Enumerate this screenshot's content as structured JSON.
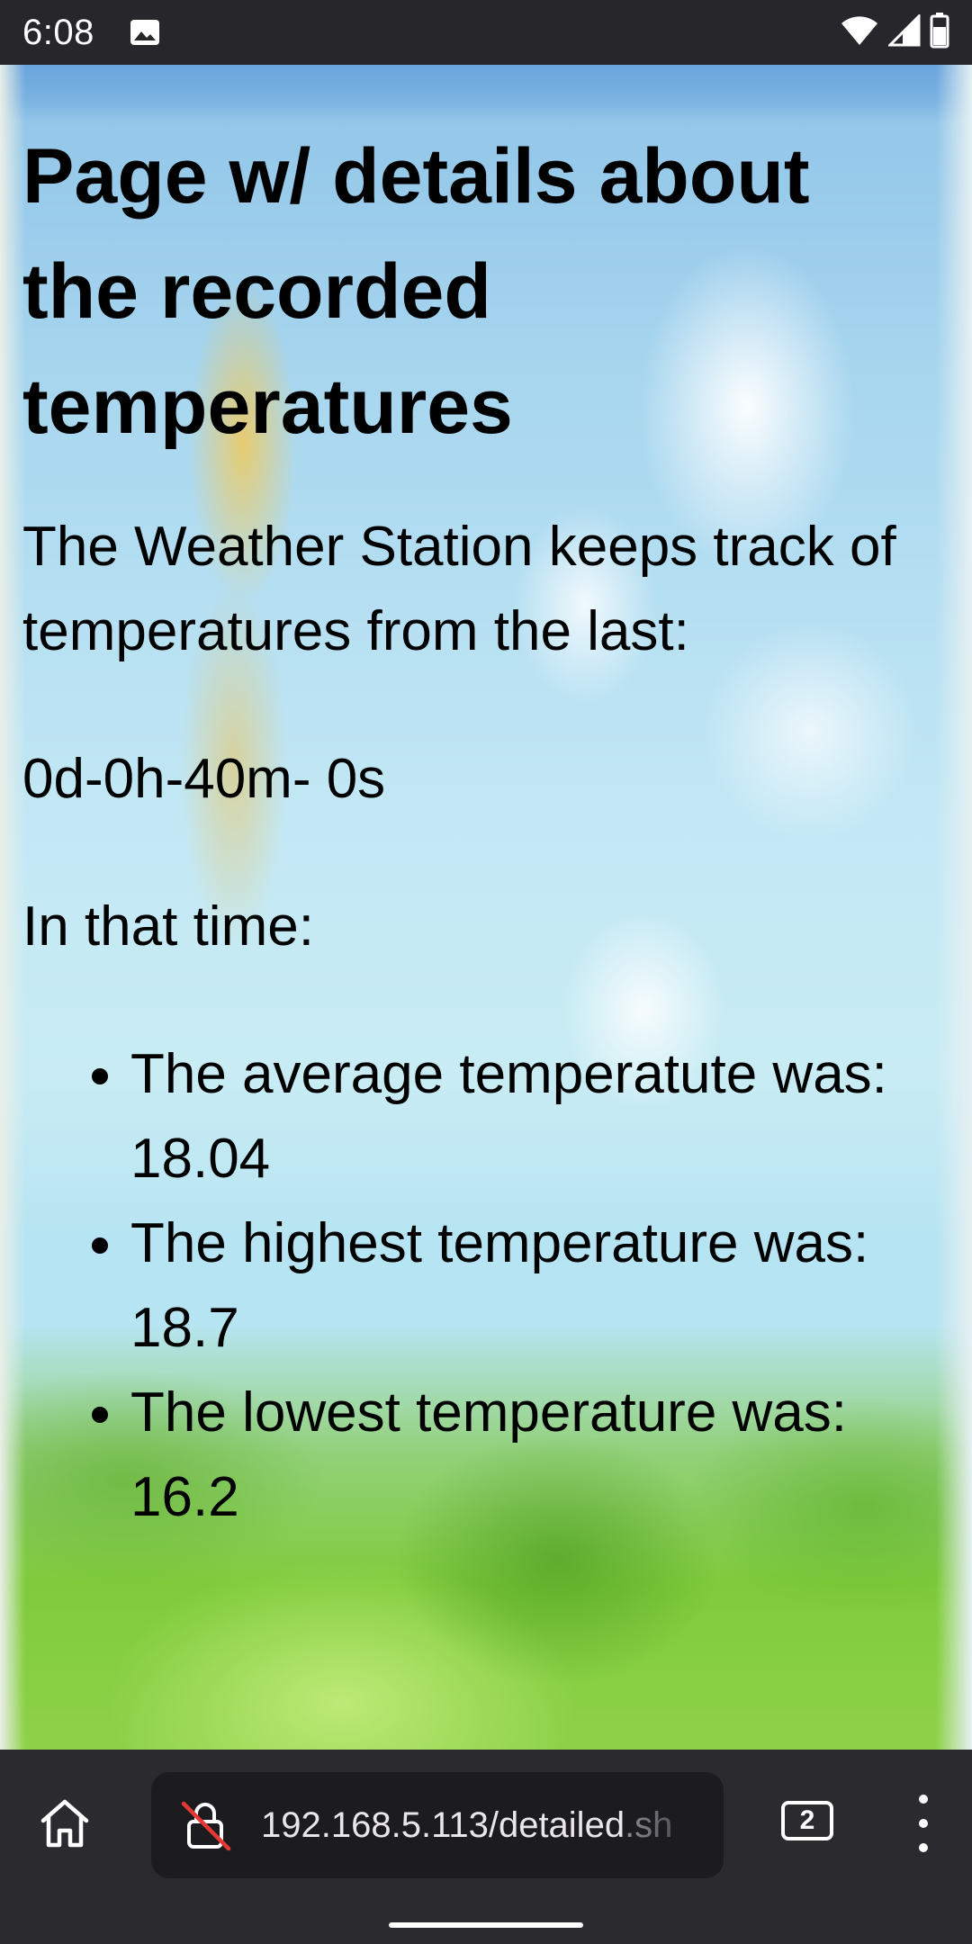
{
  "status_bar": {
    "time": "6:08",
    "icons": [
      "gallery-icon",
      "wifi-icon",
      "signal-icon",
      "battery-icon"
    ]
  },
  "page": {
    "title": "Page w/ details about the recorded temperatures",
    "intro": "The Weather Station keeps track of temperatures from the last:",
    "elapsed": "0d-0h-40m- 0s",
    "in_that_time": "In that time:",
    "stats": [
      "The average temperatute was: 18.04",
      "The highest temperature was: 18.7",
      "The lowest temperature was: 16.2"
    ]
  },
  "browser": {
    "url_host": "192.168.5.113/detailed",
    "url_rest": ".sh",
    "tab_count": "2",
    "colors": {
      "toolbar": "#2b2a2f",
      "url_field": "#1c1b1f",
      "insecure_slash": "#e53935"
    }
  }
}
